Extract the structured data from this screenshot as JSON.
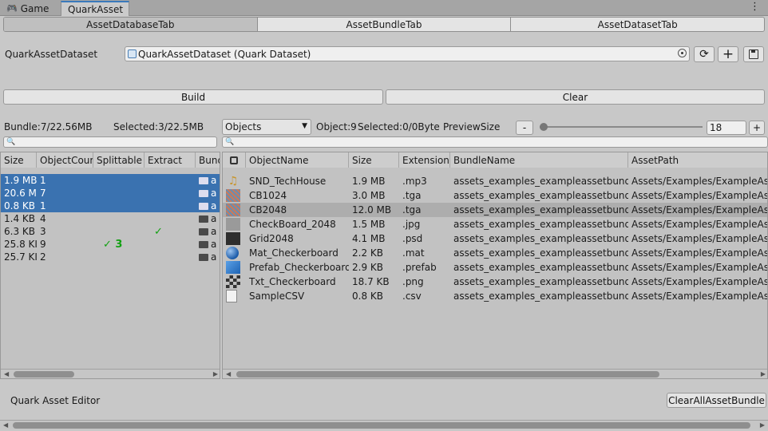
{
  "window_tabs": {
    "game": "Game",
    "quark_asset": "QuarkAsset"
  },
  "menu_dots": "⋮",
  "main_tabs": [
    "AssetDatabaseTab",
    "AssetBundleTab",
    "AssetDatasetTab"
  ],
  "dataset": {
    "label": "QuarkAssetDataset",
    "value": "QuarkAssetDataset (Quark Dataset)"
  },
  "actions": {
    "build": "Build",
    "clear": "Clear"
  },
  "left_panel": {
    "bundle_info": "Bundle:7/22.56MB",
    "selected_info": "Selected:3/22.5MB",
    "columns": [
      "Size",
      "ObjectCour",
      "Splittable",
      "Extract",
      "Bund"
    ],
    "rows": [
      {
        "size": "1.9 MB",
        "count": "1",
        "splittable": "",
        "extract": "",
        "bundle": "a"
      },
      {
        "size": "20.6 M",
        "count": "7",
        "splittable": "",
        "extract": "",
        "bundle": "a"
      },
      {
        "size": "0.8 KB",
        "count": "1",
        "splittable": "",
        "extract": "",
        "bundle": "a"
      },
      {
        "size": "1.4 KB",
        "count": "4",
        "splittable": "",
        "extract": "",
        "bundle": "a"
      },
      {
        "size": "6.3 KB",
        "count": "3",
        "splittable": "",
        "extract": "✓",
        "bundle": "a"
      },
      {
        "size": "25.8 KI",
        "count": "9",
        "splittable": "✓ 3",
        "extract": "",
        "bundle": "a"
      },
      {
        "size": "25.7 KI",
        "count": "2",
        "splittable": "",
        "extract": "",
        "bundle": "a"
      }
    ]
  },
  "right_panel": {
    "filter_value": "Objects",
    "object_info": "Object:9",
    "selected_info": "Selected:0/0Byte",
    "preview_label": "PreviewSize",
    "minus": "-",
    "plus": "+",
    "preview_value": "18",
    "preview_level": 0,
    "columns": [
      "ObjectName",
      "Size",
      "Extension",
      "BundleName",
      "AssetPath"
    ],
    "rows": [
      {
        "icon": "music-icon",
        "name": "SND_TechHouse",
        "size": "1.9 MB",
        "ext": ".mp3",
        "bundle": "assets_examples_exampleassetbundle",
        "path": "Assets/Examples/ExampleAsse"
      },
      {
        "icon": "texture-icon",
        "name": "CB1024",
        "size": "3.0 MB",
        "ext": ".tga",
        "bundle": "assets_examples_exampleassetbundle",
        "path": "Assets/Examples/ExampleAsse"
      },
      {
        "icon": "texture-icon",
        "name": "CB2048",
        "size": "12.0 MB",
        "ext": ".tga",
        "bundle": "assets_examples_exampleassetbundle",
        "path": "Assets/Examples/ExampleAsse"
      },
      {
        "icon": "grey-texture-icon",
        "name": "CheckBoard_2048",
        "size": "1.5 MB",
        "ext": ".jpg",
        "bundle": "assets_examples_exampleassetbundle",
        "path": "Assets/Examples/ExampleAsse"
      },
      {
        "icon": "dark-texture-icon",
        "name": "Grid2048",
        "size": "4.1 MB",
        "ext": ".psd",
        "bundle": "assets_examples_exampleassetbundle",
        "path": "Assets/Examples/ExampleAsse"
      },
      {
        "icon": "material-sphere-icon",
        "name": "Mat_Checkerboard",
        "size": "2.2 KB",
        "ext": ".mat",
        "bundle": "assets_examples_exampleassetbundle",
        "path": "Assets/Examples/ExampleAsse"
      },
      {
        "icon": "prefab-cube-icon",
        "name": "Prefab_Checkerboard",
        "size": "2.9 KB",
        "ext": ".prefab",
        "bundle": "assets_examples_exampleassetbundle",
        "path": "Assets/Examples/ExampleAsse"
      },
      {
        "icon": "checker-icon",
        "name": "Txt_Checkerboard",
        "size": "18.7 KB",
        "ext": ".png",
        "bundle": "assets_examples_exampleassetbundle",
        "path": "Assets/Examples/ExampleAsse"
      },
      {
        "icon": "text-file-icon",
        "name": "SampleCSV",
        "size": "0.8 KB",
        "ext": ".csv",
        "bundle": "assets_examples_exampleassetbundle",
        "path": "Assets/Examples/ExampleAsse"
      }
    ]
  },
  "footer": {
    "editor_label": "Quark Asset Editor",
    "clear_all": "ClearAllAssetBundle"
  },
  "colors": {
    "selection": "#3a72b0",
    "highlight": "#adadad",
    "check": "#12a012",
    "window_bg": "#c8c8c8"
  }
}
